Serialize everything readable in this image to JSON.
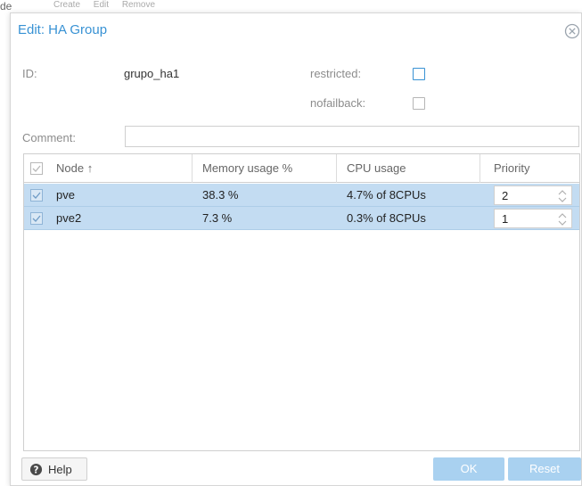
{
  "background": {
    "fragment_left": "de",
    "toolbar": [
      "Create",
      "Edit",
      "Remove"
    ]
  },
  "dialog": {
    "title": "Edit: HA Group",
    "close_icon": "close-circle-icon"
  },
  "form": {
    "id_label": "ID:",
    "id_value": "grupo_ha1",
    "restricted_label": "restricted:",
    "restricted_checked": false,
    "nofailback_label": "nofailback:",
    "nofailback_checked": false,
    "comment_label": "Comment:",
    "comment_value": ""
  },
  "grid": {
    "columns": {
      "node": "Node ↑",
      "memory": "Memory usage %",
      "cpu": "CPU usage",
      "priority": "Priority"
    },
    "rows": [
      {
        "checked": true,
        "node": "pve",
        "memory": "38.3 %",
        "cpu": "4.7% of 8CPUs",
        "priority": "2"
      },
      {
        "checked": true,
        "node": "pve2",
        "memory": "7.3 %",
        "cpu": "0.3% of 8CPUs",
        "priority": "1"
      }
    ]
  },
  "footer": {
    "help_label": "Help",
    "ok_label": "OK",
    "reset_label": "Reset"
  },
  "colors": {
    "accent": "#3892d4",
    "row_selected": "#c3dcf2",
    "button_disabled": "#a9d1f0"
  }
}
